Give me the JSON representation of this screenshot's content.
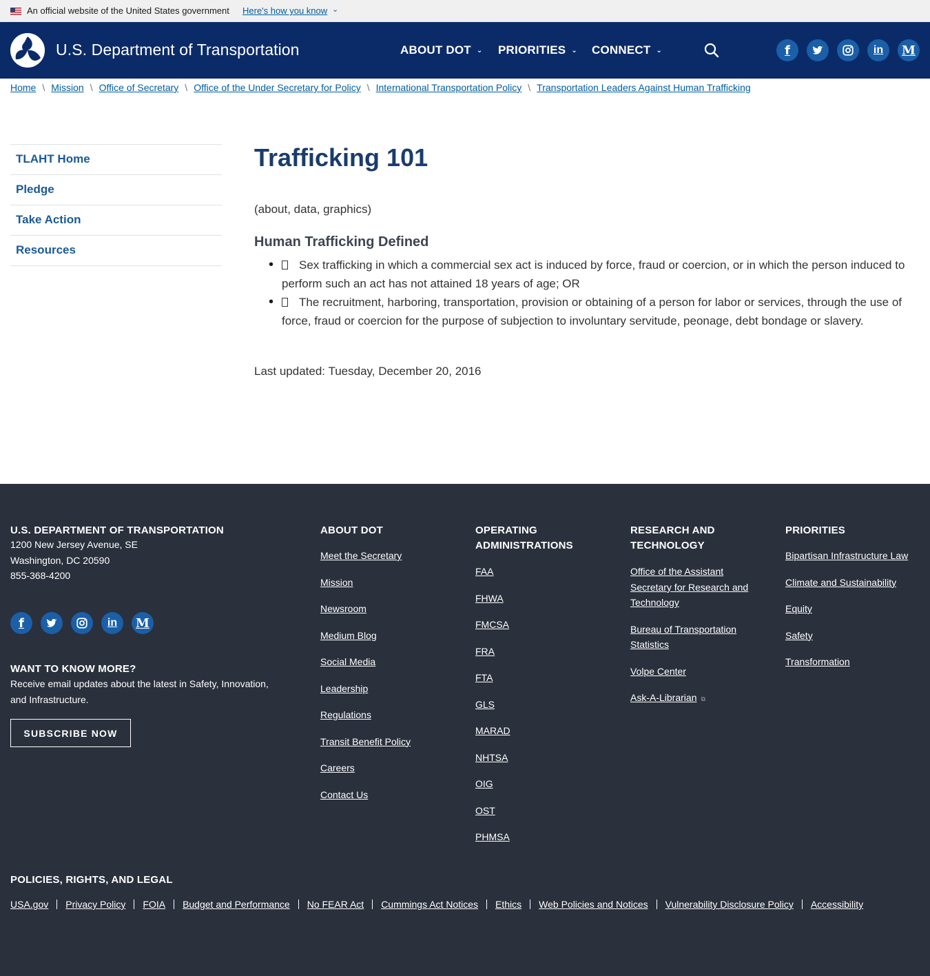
{
  "gov_banner": {
    "official_text": "An official website of the United States government",
    "how_link": "Here's how you know",
    "chevron": "⌄"
  },
  "header": {
    "site_title": "U.S. Department of Transportation",
    "nav": [
      {
        "label": "ABOUT DOT",
        "chevron": "⌄"
      },
      {
        "label": "PRIORITIES",
        "chevron": "⌄"
      },
      {
        "label": "CONNECT",
        "chevron": "⌄"
      }
    ],
    "social_icons": [
      "facebook-icon",
      "twitter-icon",
      "instagram-icon",
      "linkedin-icon",
      "medium-icon"
    ],
    "social_glyphs": {
      "facebook": "f",
      "linkedin": "in",
      "medium": "M"
    }
  },
  "breadcrumb": {
    "items": [
      "Home",
      "Mission",
      "Office of Secretary",
      "Office of the Under Secretary for Policy",
      "International Transportation Policy",
      "Transportation Leaders Against Human Trafficking"
    ],
    "separator": "\\"
  },
  "sidenav": {
    "items": [
      "TLAHT Home",
      "Pledge",
      "Take Action",
      "Resources"
    ]
  },
  "main": {
    "title": "Trafficking 101",
    "intro": "(about, data, graphics)",
    "section_heading": "Human Trafficking Defined",
    "definitions": [
      "Sex trafficking in which a commercial sex act is induced by force, fraud or coercion, or in which the person induced to perform such an act has not attained 18 years of age; OR",
      "The recruitment, harboring, transportation, provision or obtaining of a person for labor or services, through the use of force, fraud or coercion for the purpose of subjection to involuntary servitude, peonage, debt bondage or slavery."
    ],
    "last_updated": "Last updated: Tuesday, December 20, 2016"
  },
  "footer": {
    "dot": {
      "heading": "U.S. DEPARTMENT OF TRANSPORTATION",
      "address1": "1200 New Jersey Avenue, SE",
      "address2": "Washington, DC 20590",
      "phone": "855-368-4200"
    },
    "want_more": {
      "heading": "WANT TO KNOW MORE?",
      "text": "Receive email updates about the latest in Safety, Innovation, and Infrastructure.",
      "button": "SUBSCRIBE NOW"
    },
    "about": {
      "heading": "ABOUT DOT",
      "links": [
        "Meet the Secretary",
        "Mission",
        "Newsroom",
        "Medium Blog",
        "Social Media",
        "Leadership",
        "Regulations",
        "Transit Benefit Policy",
        "Careers",
        "Contact Us"
      ]
    },
    "operating": {
      "heading": "OPERATING ADMINISTRATIONS",
      "links": [
        "FAA",
        "FHWA",
        "FMCSA",
        "FRA",
        "FTA",
        "GLS",
        "MARAD",
        "NHTSA",
        "OIG",
        "OST",
        "PHMSA"
      ]
    },
    "research": {
      "heading": "RESEARCH AND TECHNOLOGY",
      "links": [
        "Office of the Assistant Secretary for Research and Technology",
        "Bureau of Transportation Statistics",
        "Volpe Center",
        "Ask-A-Librarian"
      ]
    },
    "priorities": {
      "heading": "PRIORITIES",
      "links": [
        "Bipartisan Infrastructure Law",
        "Climate and Sustainability",
        "Equity",
        "Safety",
        "Transformation"
      ]
    },
    "legal": {
      "heading": "POLICIES, RIGHTS, AND LEGAL",
      "links": [
        "USA.gov",
        "Privacy Policy",
        "FOIA",
        "Budget and Performance",
        "No FEAR Act",
        "Cummings Act Notices",
        "Ethics",
        "Web Policies and Notices",
        "Vulnerability Disclosure Policy",
        "Accessibility"
      ]
    }
  },
  "colors": {
    "header_bg": "#0b2b68",
    "link": "#005ea2",
    "title": "#1a3c6e",
    "footer_bg": "#2a303c",
    "social_bg": "#1a5fa8"
  }
}
